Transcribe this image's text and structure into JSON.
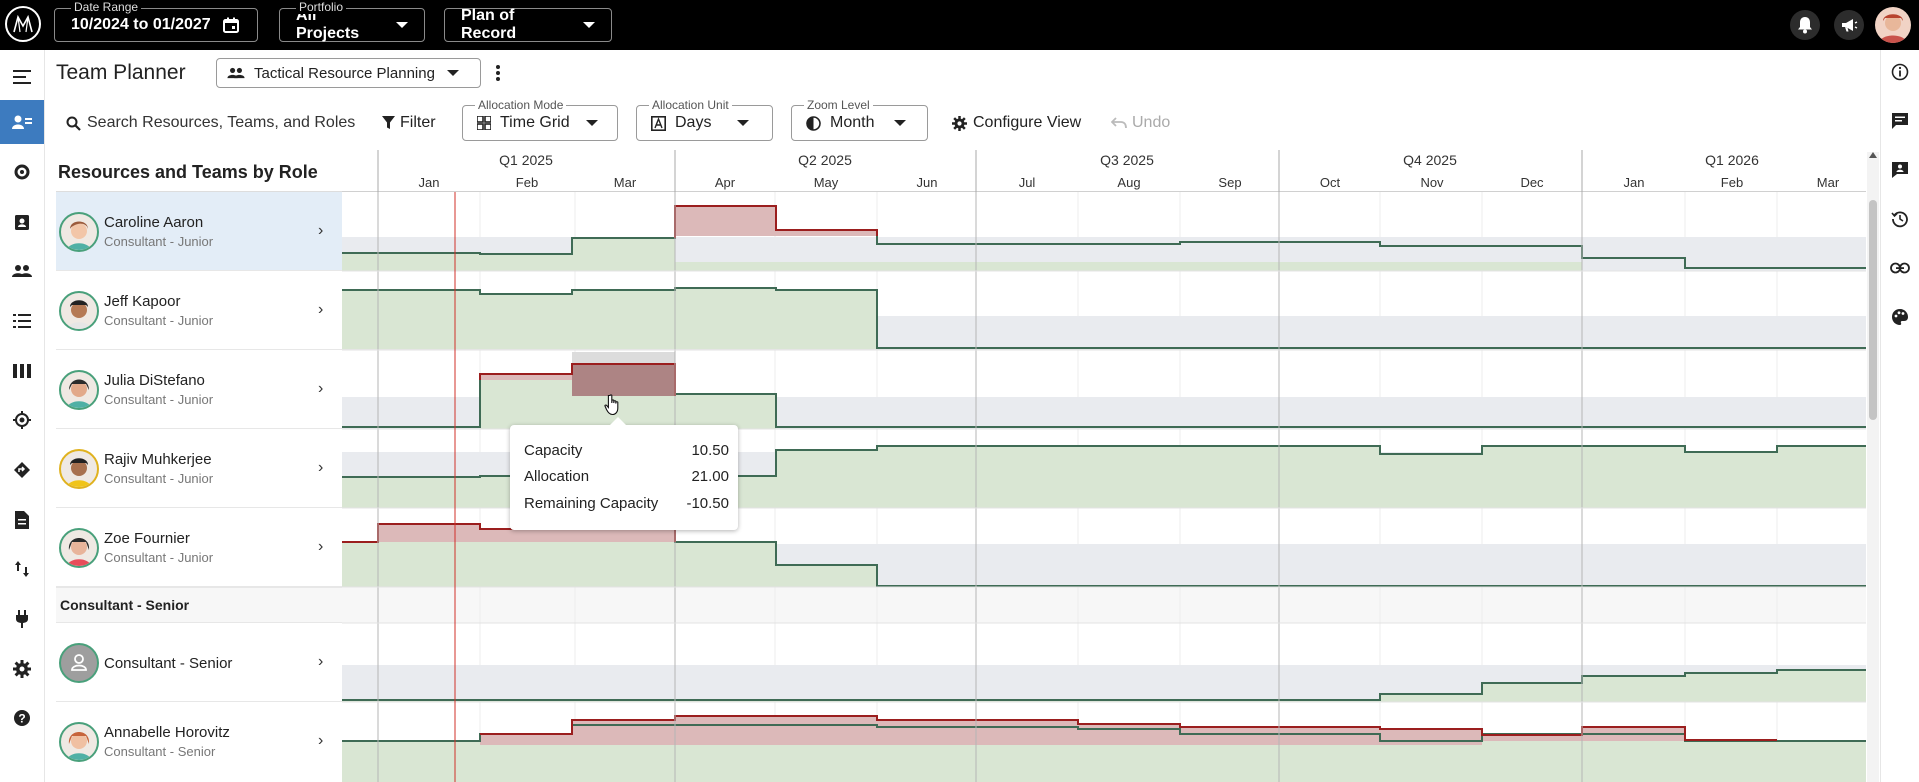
{
  "topbar": {
    "date_range_label": "Date Range",
    "date_range_value": "10/2024 to 01/2027",
    "portfolio_label": "Portfolio",
    "portfolio_value": "All Projects",
    "plan_value": "Plan of Record"
  },
  "header": {
    "title": "Team Planner",
    "view_name": "Tactical Resource Planning"
  },
  "toolbar": {
    "search_placeholder": "Search Resources, Teams, and Roles",
    "filter_label": "Filter",
    "allocation_mode_label": "Allocation Mode",
    "allocation_mode_value": "Time Grid",
    "allocation_unit_label": "Allocation Unit",
    "allocation_unit_value": "Days",
    "zoom_level_label": "Zoom Level",
    "zoom_level_value": "Month",
    "configure_view_label": "Configure View",
    "undo_label": "Undo"
  },
  "grid": {
    "left_header": "Resources and Teams by Role",
    "quarters": [
      "Q1 2025",
      "Q2 2025",
      "Q3 2025",
      "Q4 2025",
      "Q1 2026"
    ],
    "months": [
      "Jan",
      "Feb",
      "Mar",
      "Apr",
      "May",
      "Jun",
      "Jul",
      "Aug",
      "Sep",
      "Oct",
      "Nov",
      "Dec",
      "Jan",
      "Feb",
      "Mar"
    ],
    "rows": [
      {
        "name": "Caroline Aaron",
        "role": "Consultant - Junior"
      },
      {
        "name": "Jeff Kapoor",
        "role": "Consultant - Junior"
      },
      {
        "name": "Julia DiStefano",
        "role": "Consultant - Junior"
      },
      {
        "name": "Rajiv Muhkerjee",
        "role": "Consultant - Junior"
      },
      {
        "name": "Zoe Fournier",
        "role": "Consultant - Junior"
      }
    ],
    "group_header": "Consultant - Senior",
    "rows2": [
      {
        "name": "Consultant - Senior",
        "role": ""
      },
      {
        "name": "Annabelle Horovitz",
        "role": "Consultant - Senior"
      }
    ]
  },
  "tooltip": {
    "capacity_label": "Capacity",
    "capacity_value": "10.50",
    "allocation_label": "Allocation",
    "allocation_value": "21.00",
    "remaining_label": "Remaining Capacity",
    "remaining_value": "-10.50"
  },
  "colors": {
    "topbar": "#000000",
    "active_nav": "#3d7bbf",
    "capacity_fill": "#d9e6d3",
    "capacity_line": "#3f6b55",
    "over_fill": "#dcb9b9",
    "over_line": "#9b1e1e",
    "unused_fill": "#e9ebef",
    "today_line": "#d0302a"
  },
  "icons": [
    "app-logo-icon",
    "calendar-icon",
    "bell-icon",
    "megaphone-icon",
    "user-avatar-icon",
    "menu-icon",
    "team-planner-icon",
    "refresh-icon",
    "portfolio-icon",
    "people-icon",
    "list-icon",
    "columns-icon",
    "target-icon",
    "route-icon",
    "document-icon",
    "transfer-icon",
    "plug-icon",
    "gear-icon",
    "help-icon",
    "info-icon",
    "chat-icon",
    "comment-icon",
    "history-icon",
    "link-icon",
    "palette-icon"
  ]
}
